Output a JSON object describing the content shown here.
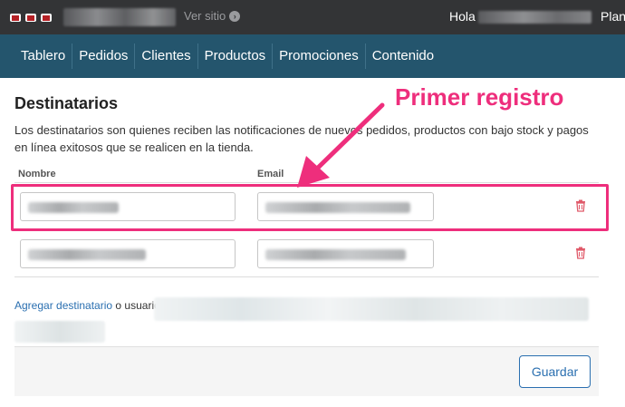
{
  "topbar": {
    "view_site": "Ver sitio",
    "hello": "Hola",
    "plan": "Plan"
  },
  "nav": {
    "items": [
      "Tablero",
      "Pedidos",
      "Clientes",
      "Productos",
      "Promociones",
      "Contenido"
    ]
  },
  "section": {
    "title": "Destinatarios",
    "description": "Los destinatarios son quienes reciben las notificaciones de nuevos pedidos, productos con bajo stock y pagos en línea exitosos que se realicen en la tienda."
  },
  "columns": {
    "name": "Nombre",
    "email": "Email"
  },
  "annotation": {
    "text": "Primer registro",
    "color": "#ee2e7c"
  },
  "add": {
    "link": "Agregar destinatario",
    "suffix": "o usuario:"
  },
  "actions": {
    "save": "Guardar"
  },
  "colors": {
    "topbar": "#333436",
    "nav": "#24556d",
    "link": "#2a6fb0",
    "trash": "#e05a6a"
  }
}
